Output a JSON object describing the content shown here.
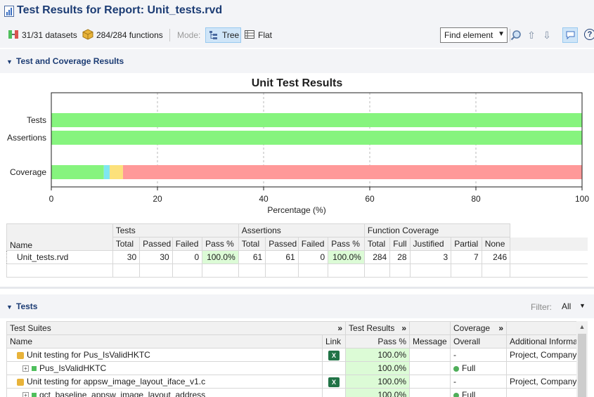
{
  "header": {
    "title": "Test Results for Report: Unit_tests.rvd"
  },
  "toolbar": {
    "datasets": "31/31 datasets",
    "functions": "284/284 functions",
    "mode_label": "Mode:",
    "tree_label": "Tree",
    "flat_label": "Flat",
    "find_placeholder": "Find element"
  },
  "section1": {
    "title": "Test and Coverage Results"
  },
  "chart_data": {
    "type": "bar",
    "orientation": "horizontal",
    "stacked": true,
    "title": "Unit Test Results",
    "xlabel": "Percentage (%)",
    "ylabel": "",
    "xlim": [
      0,
      100
    ],
    "xticks": [
      "0",
      "20",
      "40",
      "60",
      "80",
      "100"
    ],
    "categories": [
      "Tests",
      "Assertions",
      "Coverage"
    ],
    "series": [
      {
        "color": "#86f47e",
        "values": [
          100,
          100,
          9.9
        ]
      },
      {
        "color": "#7fe6f0",
        "values": [
          0,
          0,
          1.1
        ]
      },
      {
        "color": "#fce17b",
        "values": [
          0,
          0,
          2.5
        ]
      },
      {
        "color": "#ff9999",
        "values": [
          0,
          0,
          86.5
        ]
      }
    ],
    "grid": true
  },
  "summary": {
    "groups": {
      "tests": "Tests",
      "assertions": "Assertions",
      "coverage": "Function Coverage"
    },
    "cols": {
      "name": "Name",
      "total": "Total",
      "passed": "Passed",
      "failed": "Failed",
      "pass_pct": "Pass %",
      "full": "Full",
      "justified": "Justified",
      "partial": "Partial",
      "none": "None"
    },
    "row": {
      "name": "Unit_tests.rvd",
      "t_total": "30",
      "t_passed": "30",
      "t_failed": "0",
      "t_pass": "100.0%",
      "a_total": "61",
      "a_passed": "61",
      "a_failed": "0",
      "a_pass": "100.0%",
      "f_total": "284",
      "f_full": "28",
      "f_justified": "3",
      "f_partial": "7",
      "f_none": "246"
    }
  },
  "section2": {
    "title": "Tests",
    "filter_label": "Filter:",
    "filter_value": "All"
  },
  "tests_table": {
    "groups": {
      "suites": "Test Suites",
      "results": "Test Results",
      "coverage": "Coverage"
    },
    "cols": {
      "name": "Name",
      "link": "Link",
      "pass_pct": "Pass %",
      "message": "Message",
      "overall": "Overall",
      "additional": "Additional Information"
    },
    "rows": [
      {
        "name": "Unit testing for Pus_IsValidHKTC",
        "pass": "100.0%",
        "overall": "-",
        "additional": "Project, Company"
      },
      {
        "name": "Pus_IsValidHKTC",
        "pass": "100.0%",
        "overall": "Full",
        "additional": ""
      },
      {
        "name": "Unit testing for appsw_image_layout_iface_v1.c",
        "pass": "100.0%",
        "overall": "-",
        "additional": "Project, Company"
      },
      {
        "name": "gct_baseline_appsw_image_layout_address",
        "pass": "100.0%",
        "overall": "Full",
        "additional": ""
      }
    ]
  },
  "colors": {
    "accent": "#1c3c74",
    "pass_bg": "#dcfbd6",
    "selected_bg": "#cfe5f8"
  }
}
